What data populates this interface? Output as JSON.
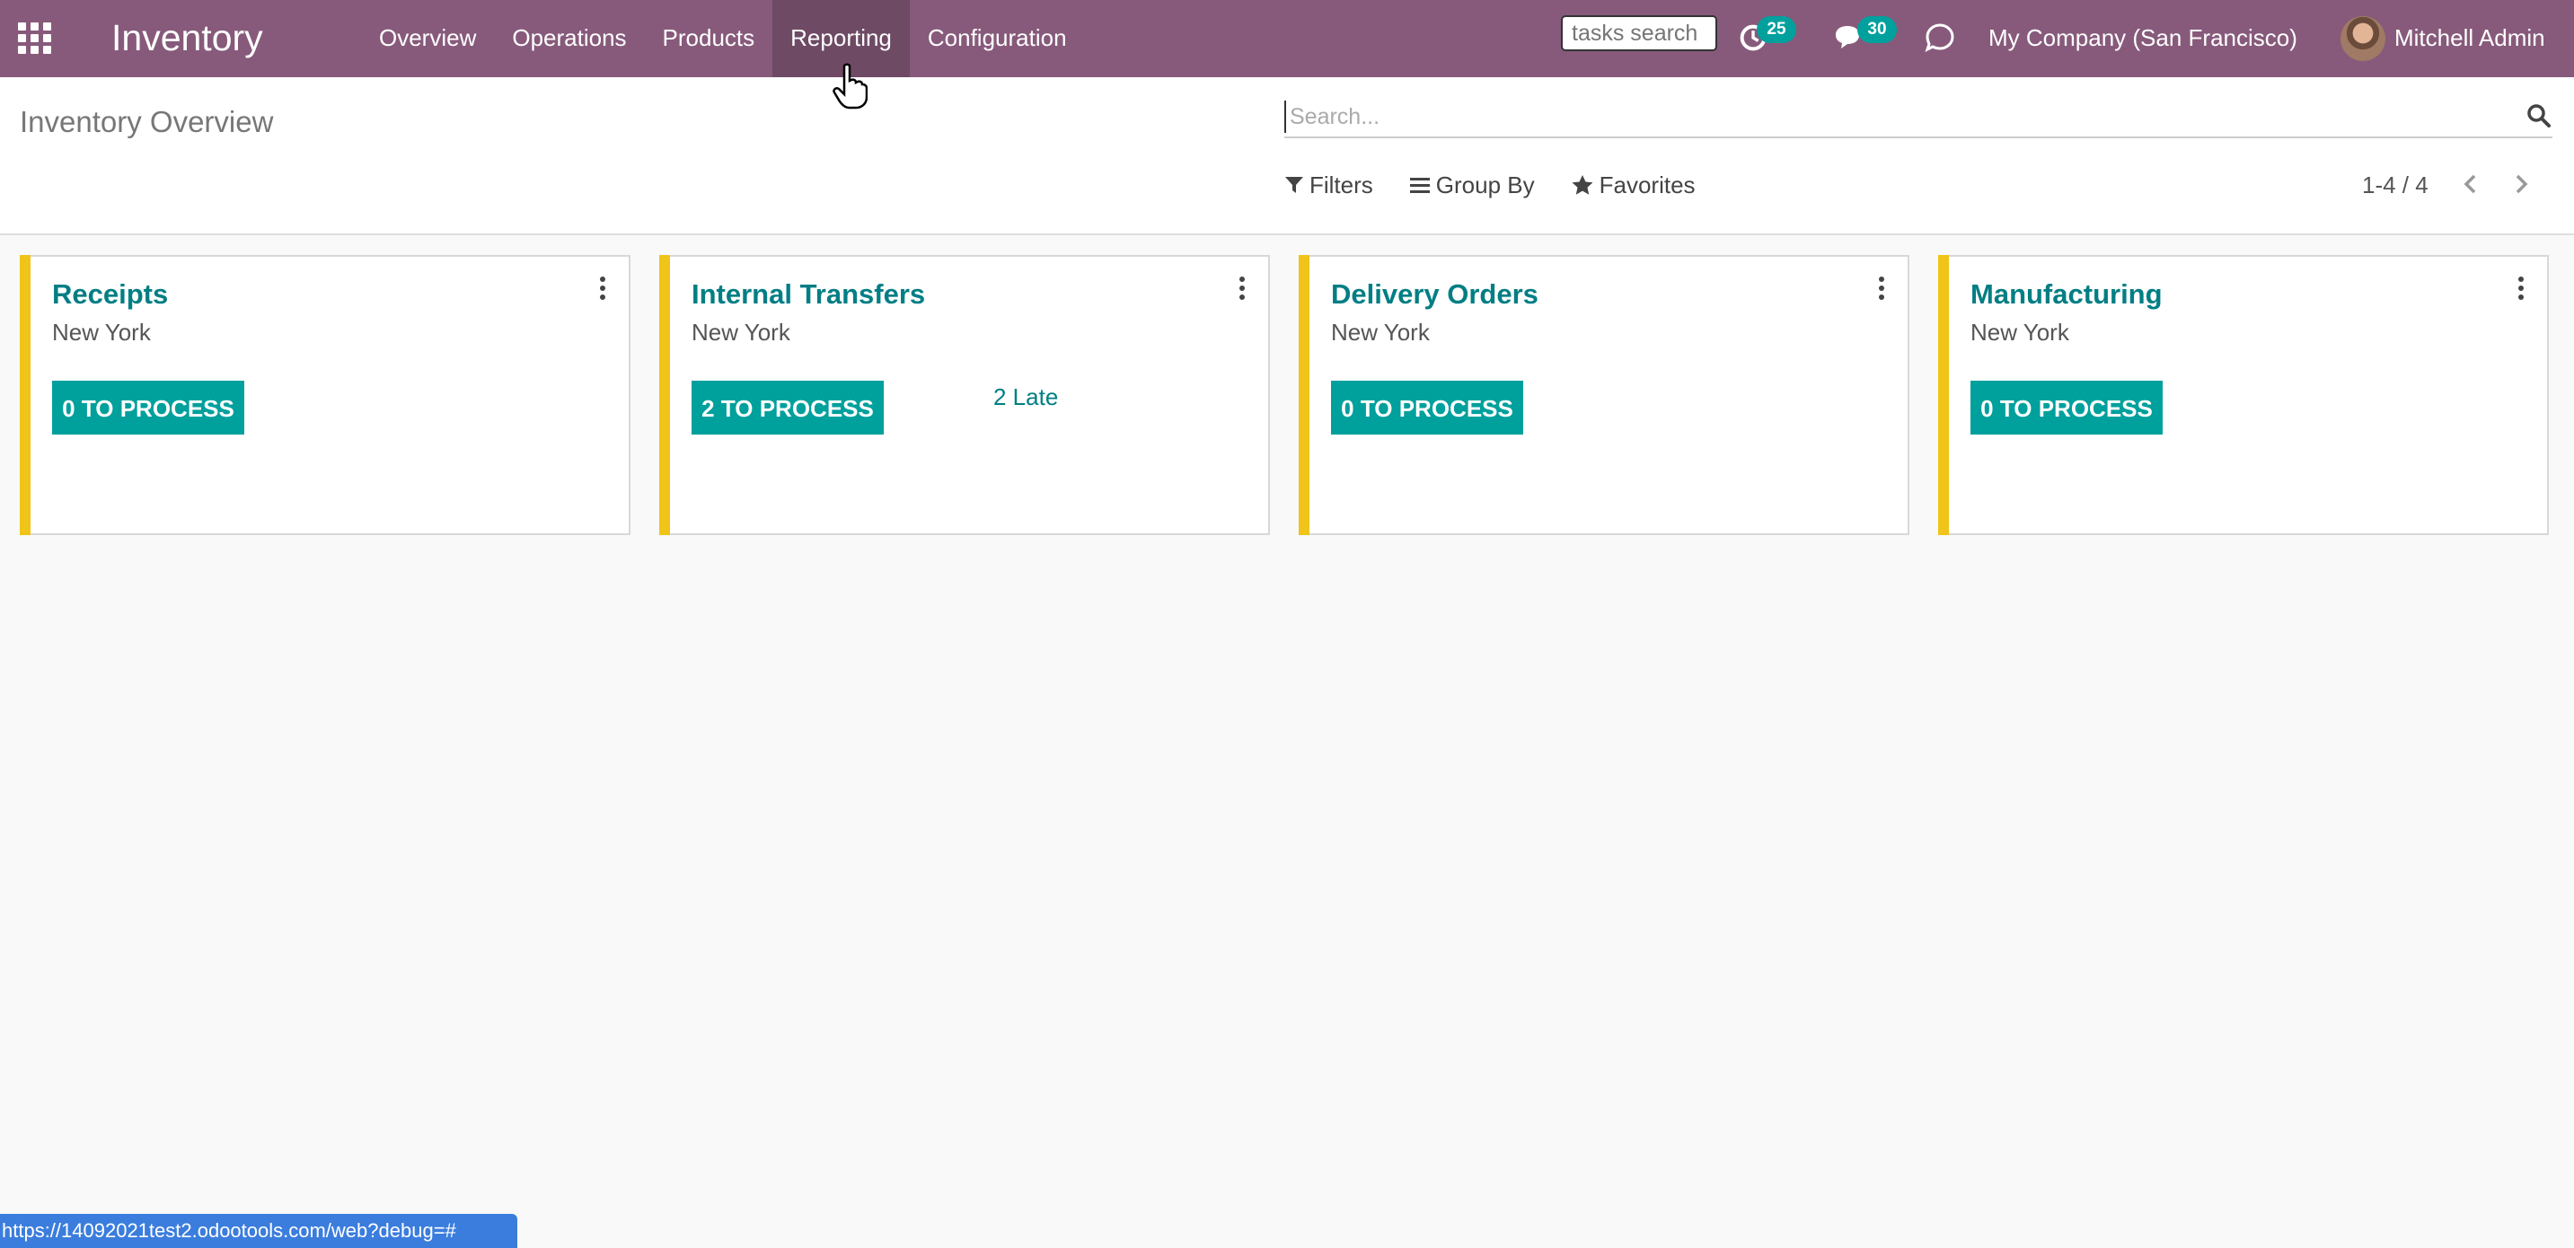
{
  "navbar": {
    "app_title": "Inventory",
    "menu": [
      "Overview",
      "Operations",
      "Products",
      "Reporting",
      "Configuration"
    ],
    "active_menu": "Reporting",
    "tasks_search_placeholder": "tasks search",
    "activity_count": "25",
    "message_count": "30",
    "company": "My Company (San Francisco)",
    "user": "Mitchell Admin",
    "bg_color": "#875a7b"
  },
  "control_panel": {
    "title": "Inventory Overview",
    "search_placeholder": "Search...",
    "filters": "Filters",
    "group_by": "Group By",
    "favorites": "Favorites",
    "pager": "1-4 / 4"
  },
  "cards": [
    {
      "title": "Receipts",
      "subtitle": "New York",
      "button": "0 TO PROCESS",
      "late": ""
    },
    {
      "title": "Internal Transfers",
      "subtitle": "New York",
      "button": "2 TO PROCESS",
      "late": "2 Late"
    },
    {
      "title": "Delivery Orders",
      "subtitle": "New York",
      "button": "0 TO PROCESS",
      "late": ""
    },
    {
      "title": "Manufacturing",
      "subtitle": "New York",
      "button": "0 TO PROCESS",
      "late": ""
    }
  ],
  "status_bar": {
    "url": "https://14092021test2.odootools.com/web?debug=#"
  },
  "colors": {
    "accent": "#00a09d",
    "link": "#017e84",
    "card_stripe": "#f0c419"
  }
}
